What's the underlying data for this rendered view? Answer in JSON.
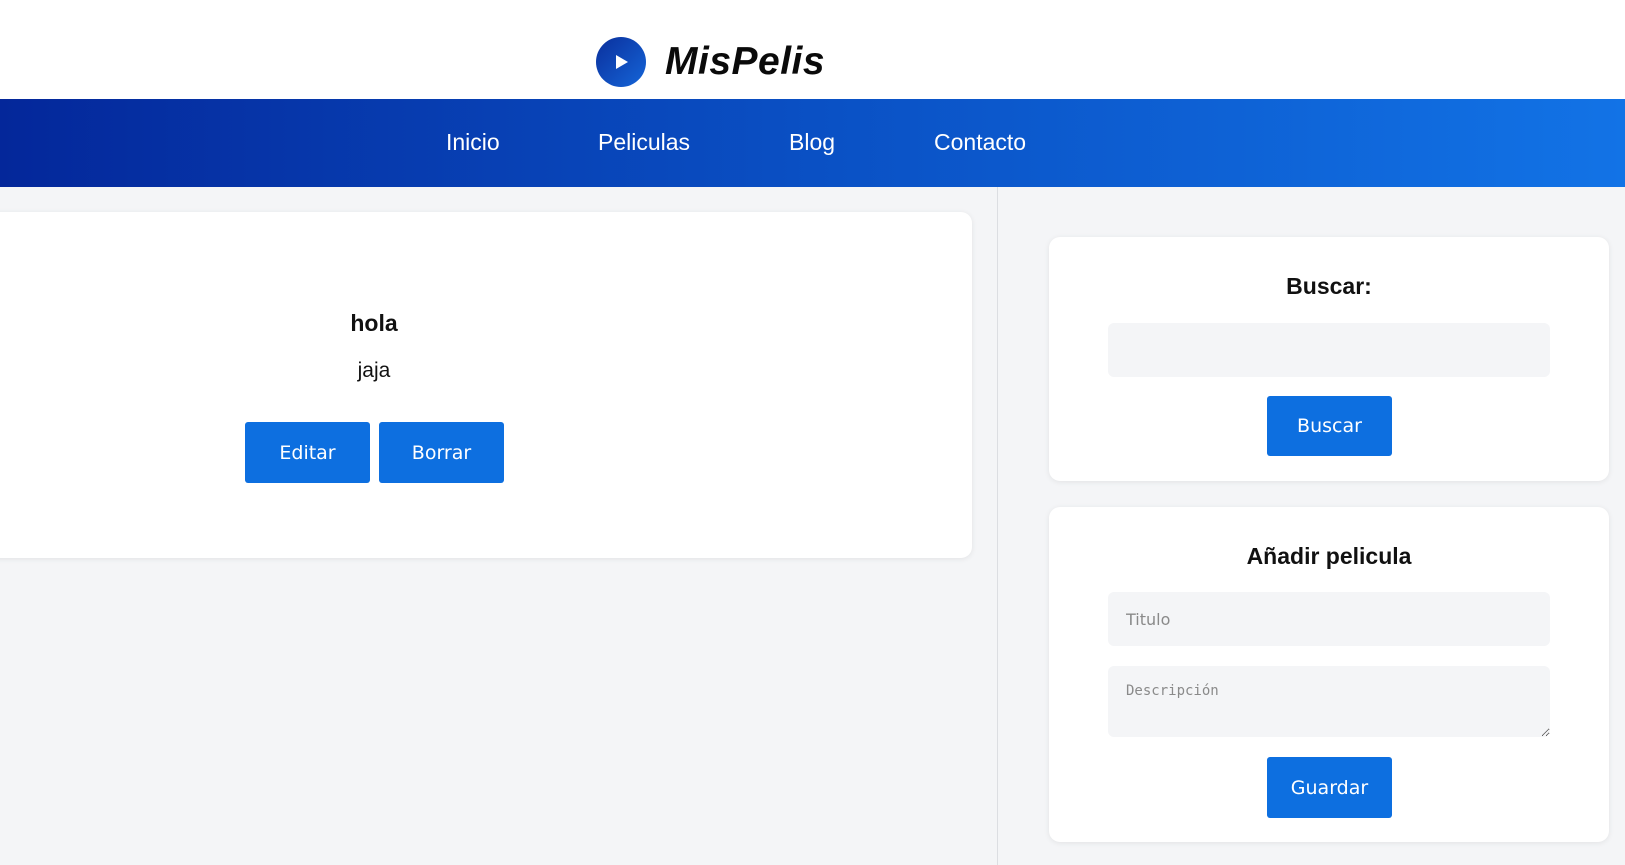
{
  "header": {
    "brand": "MisPelis",
    "logo_icon": "play-icon",
    "logo_gradient": [
      "#0a2f9c",
      "#1565d8"
    ]
  },
  "nav": {
    "items": [
      {
        "label": "Inicio"
      },
      {
        "label": "Peliculas"
      },
      {
        "label": "Blog"
      },
      {
        "label": "Contacto"
      }
    ],
    "gradient": [
      "#04279a",
      "#1273e6"
    ]
  },
  "movie": {
    "title": "hola",
    "description": "jaja",
    "edit_label": "Editar",
    "delete_label": "Borrar"
  },
  "search": {
    "title": "Buscar:",
    "value": "",
    "button_label": "Buscar"
  },
  "add_movie": {
    "title": "Añadir pelicula",
    "title_placeholder": "Titulo",
    "description_placeholder": "Descripción",
    "button_label": "Guardar"
  },
  "colors": {
    "accent": "#0d6fe0",
    "page_bg": "#f4f5f7",
    "card_bg": "#ffffff"
  }
}
